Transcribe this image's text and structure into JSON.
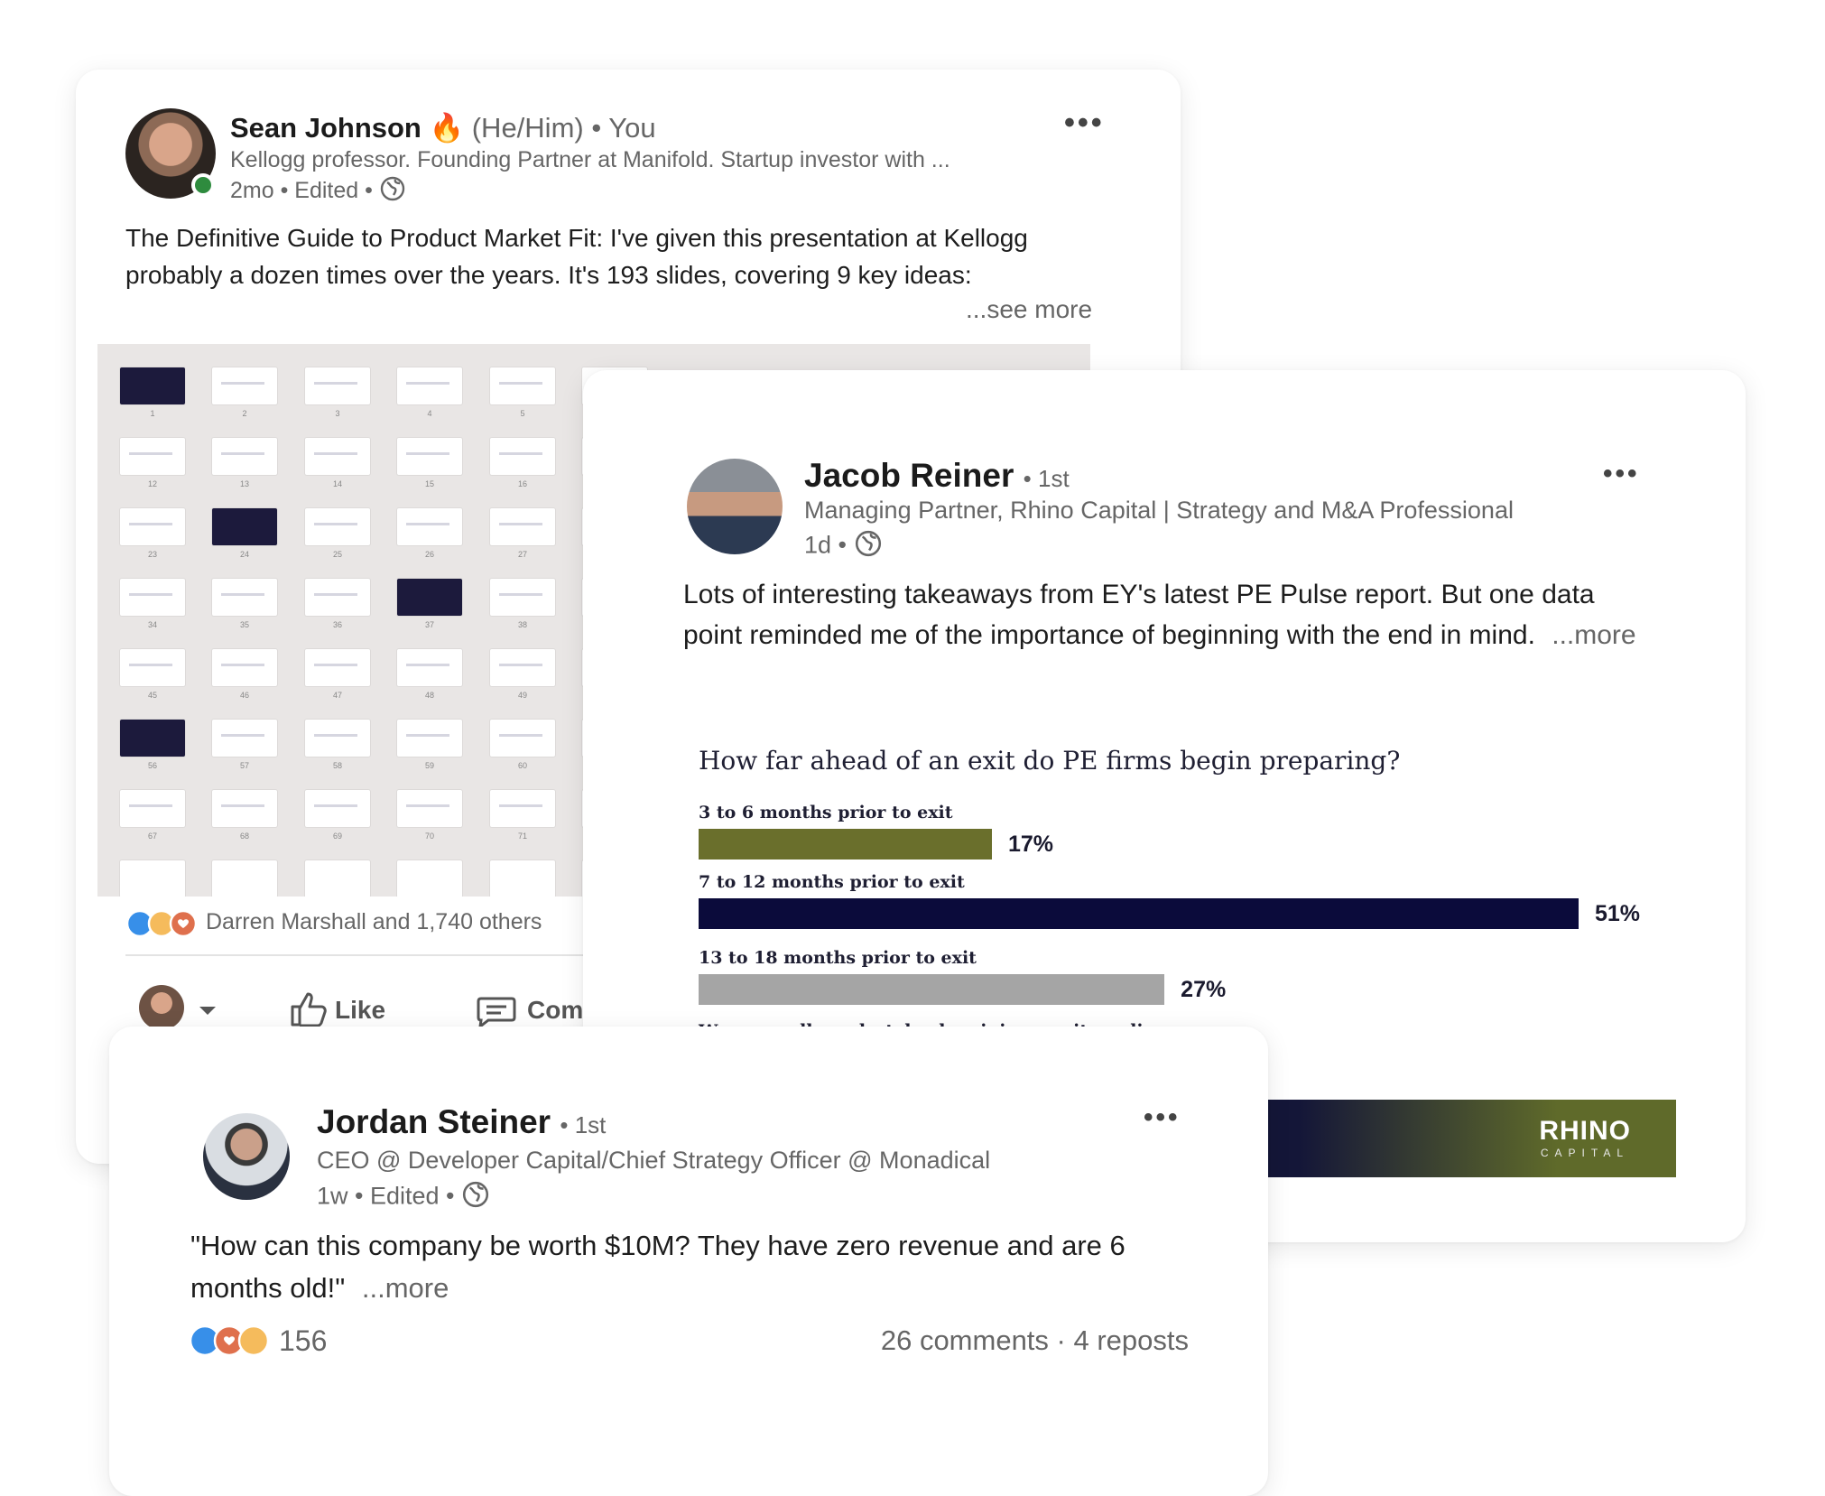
{
  "posts": [
    {
      "author": "Sean Johnson",
      "emoji": "🔥",
      "pronouns": "(He/Him)",
      "relation": "You",
      "headline": "Kellogg professor. Founding Partner at Manifold. Startup investor with ...",
      "time": "2mo",
      "edited": "Edited",
      "body": "The Definitive Guide to Product Market Fit: I've given this presentation at Kellogg probably a dozen times over the years. It's 193 slides, covering 9 key ideas:",
      "see_more": "...see more",
      "reactions_text": "Darren Marshall and 1,740 others",
      "like_label": "Like",
      "comment_label": "Com",
      "thumb_numbers": [
        "1",
        "2",
        "3",
        "4",
        "5",
        "12",
        "13",
        "14",
        "15",
        "16",
        "23",
        "24",
        "25",
        "26",
        "27",
        "34",
        "35",
        "36",
        "37",
        "38",
        "45",
        "46",
        "47",
        "48",
        "49",
        "56",
        "57",
        "58",
        "59",
        "60",
        "67",
        "68",
        "69",
        "70",
        "71"
      ]
    },
    {
      "author": "Jacob Reiner",
      "degree": "1st",
      "headline": "Managing Partner, Rhino Capital | Strategy and M&A Professional",
      "time": "1d",
      "body": "Lots of interesting takeaways from EY's latest PE Pulse report. But one data point reminded me of the importance of beginning with the end in mind.",
      "more": "...more",
      "logo_main": "RHINO",
      "logo_sub": "CAPITAL"
    },
    {
      "author": "Jordan Steiner",
      "degree": "1st",
      "headline": "CEO @ Developer Capital/Chief Strategy Officer @ Monadical",
      "time": "1w",
      "edited": "Edited",
      "body": "\"How can this company be worth $10M? They have zero revenue and are 6 months old!\"",
      "more": "...more",
      "reaction_count": "156",
      "comments": "26 comments",
      "reposts": "4 reposts"
    }
  ],
  "chart_data": {
    "type": "bar",
    "title": "How far ahead of an exit do PE firms begin preparing?",
    "categories": [
      "3 to 6 months prior to exit",
      "7 to 12 months prior to exit",
      "13 to 18 months prior to exit",
      "We generally undertake de minimus exit readiness"
    ],
    "values": [
      17,
      51,
      27,
      null
    ],
    "value_labels": [
      "17%",
      "51%",
      "27%",
      ""
    ],
    "colors": [
      "#6a6f2c",
      "#0b0b3b",
      "#a5a5a5",
      "#a5a5a5"
    ],
    "xlim": [
      0,
      55
    ]
  },
  "colors": {
    "online": "#2e8b3e",
    "like_blue": "#378fe9",
    "heart_red": "#df704d",
    "insight_gold": "#f5bb5c",
    "rhino_green": "#5f6a2a",
    "rhino_navy": "#141638"
  }
}
